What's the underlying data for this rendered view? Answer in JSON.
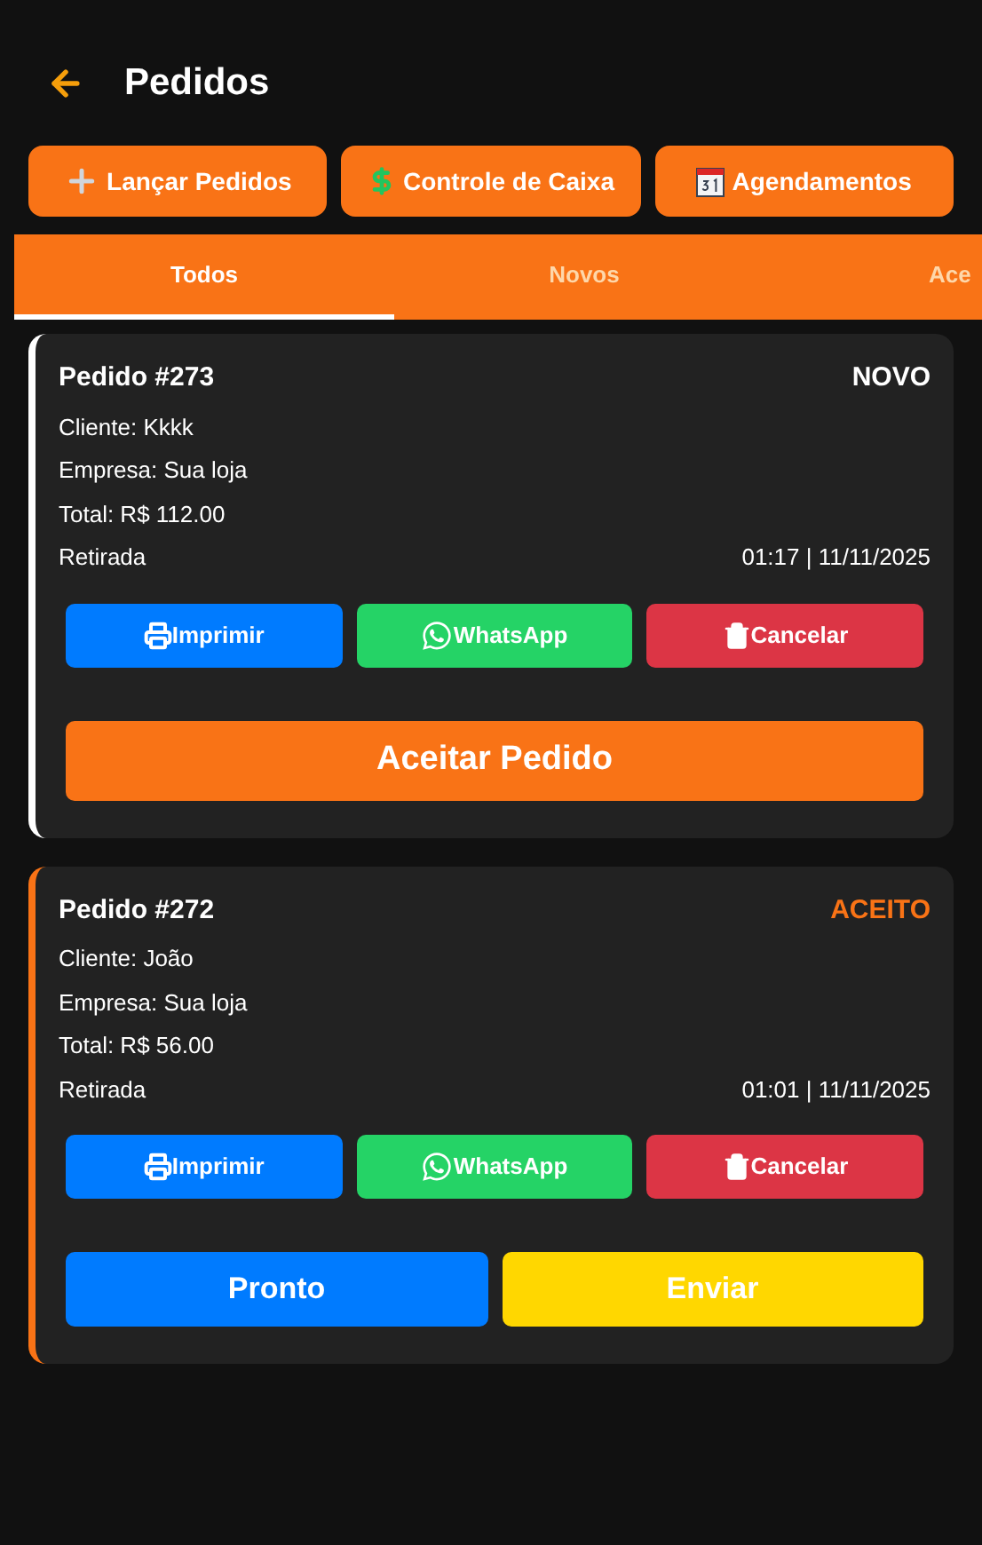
{
  "header": {
    "title": "Pedidos"
  },
  "quick_actions": [
    {
      "kind": "add",
      "label": "Lançar Pedidos"
    },
    {
      "kind": "cash",
      "label": "Controle de Caixa"
    },
    {
      "kind": "calendar",
      "label": "Agendamentos"
    }
  ],
  "tabs": [
    {
      "label": "Todos",
      "selected": true
    },
    {
      "label": "Novos",
      "selected": false
    },
    {
      "label": "Ace",
      "selected": false
    }
  ],
  "orders": [
    {
      "title": "Pedido #273",
      "status": "NOVO",
      "color": "#ffffff",
      "client": "Cliente: Kkkk",
      "company": "Empresa: Sua loja",
      "total": "Total: R$ 112.00",
      "delivery": "Retirada",
      "time": "01:17 | 11/11/2025",
      "actions": [
        {
          "kind": "print",
          "label": "Imprimir"
        },
        {
          "kind": "whatsapp",
          "label": "WhatsApp"
        },
        {
          "kind": "cancel",
          "label": "Cancelar"
        }
      ],
      "buttons": [
        {
          "kind": "accept",
          "label": "Aceitar Pedido"
        }
      ]
    },
    {
      "title": "Pedido #272",
      "status": "ACEITO",
      "color": "#f97316",
      "client": "Cliente: João",
      "company": "Empresa: Sua loja",
      "total": "Total: R$ 56.00",
      "delivery": "Retirada",
      "time": "01:01 | 11/11/2025",
      "actions": [
        {
          "kind": "print",
          "label": "Imprimir"
        },
        {
          "kind": "whatsapp",
          "label": "WhatsApp"
        },
        {
          "kind": "cancel",
          "label": "Cancelar"
        }
      ],
      "buttons": [
        {
          "kind": "ready",
          "label": "Pronto"
        },
        {
          "kind": "send",
          "label": "Enviar"
        }
      ]
    }
  ]
}
